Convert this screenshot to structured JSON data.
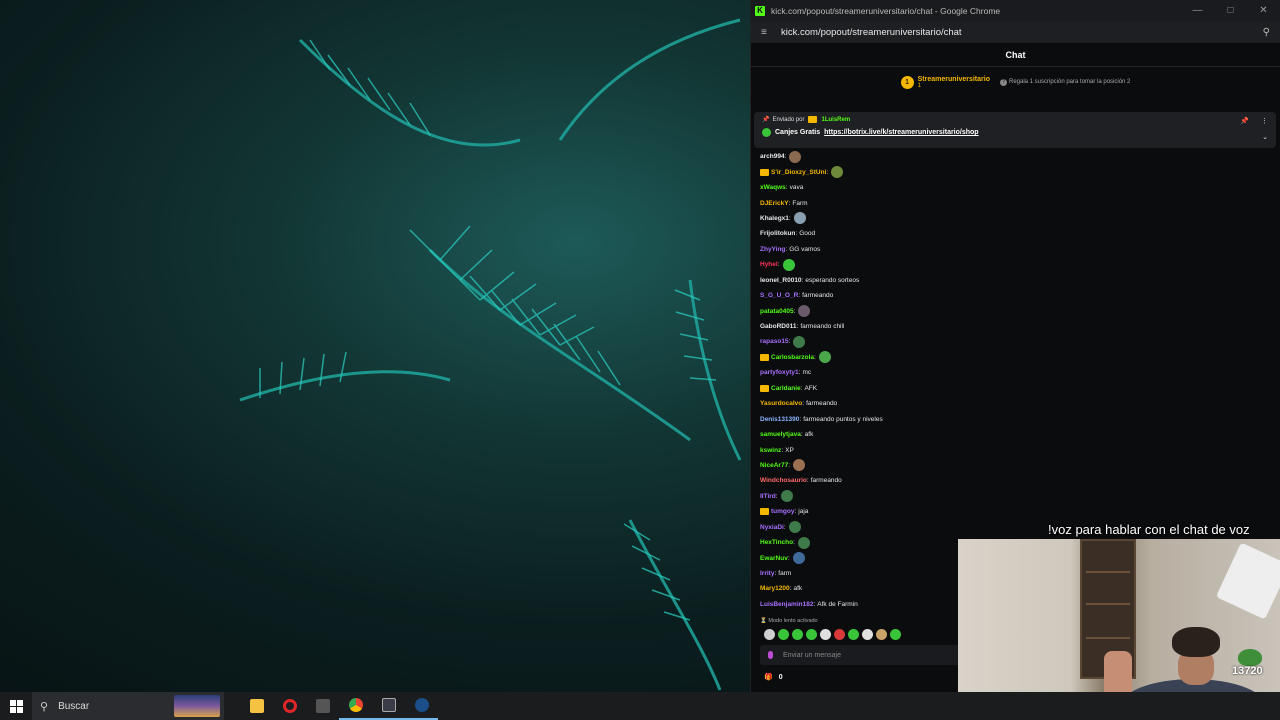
{
  "window": {
    "title": "kick.com/popout/streameruniversitario/chat - Google Chrome",
    "favicon": "K",
    "url": "kick.com/popout/streameruniversitario/chat"
  },
  "chat": {
    "header": "Chat",
    "leaderboard": {
      "rank": "1",
      "name": "Streameruniversitario",
      "count": "1",
      "tip": "Regala 1 suscripción para tomar la posición 2"
    },
    "pinned": {
      "sent_by_label": "Enviado por",
      "sent_by_user": "1LuisRem",
      "title": "Canjes Gratis",
      "link": "https://botrix.live/k/streameruniversitario/shop"
    },
    "messages": [
      {
        "user": "arch994",
        "text": "",
        "color": "#e6e6e6",
        "badge": false,
        "emote": "#8a6a50"
      },
      {
        "user": "S'ir_Dioxzy_StUni",
        "text": "",
        "color": "#f5b800",
        "badge": true,
        "emote": "#6f8a3a"
      },
      {
        "user": "xWaqws",
        "text": "vava",
        "color": "#53fc18",
        "badge": false,
        "emote": ""
      },
      {
        "user": "DJErickY",
        "text": "Farm",
        "color": "#f5b800",
        "badge": false,
        "emote": ""
      },
      {
        "user": "Khalegx1",
        "text": "",
        "color": "#e6e6e6",
        "badge": false,
        "emote": "#8aa0b0"
      },
      {
        "user": "Frijolitokun",
        "text": "Good",
        "color": "#e6e6e6",
        "badge": false,
        "emote": ""
      },
      {
        "user": "ZhyYing",
        "text": "GG vamos",
        "color": "#a970ff",
        "badge": false,
        "emote": ""
      },
      {
        "user": "Hyhel",
        "text": "",
        "color": "#ff3355",
        "badge": false,
        "emote": "#3ac43a"
      },
      {
        "user": "leonel_R0010",
        "text": "esperando sorteos",
        "color": "#e6e6e6",
        "badge": false,
        "emote": ""
      },
      {
        "user": "S_G_U_O_R",
        "text": "farmeando",
        "color": "#a970ff",
        "badge": false,
        "emote": ""
      },
      {
        "user": "patata0405",
        "text": "",
        "color": "#53fc18",
        "badge": false,
        "emote": "#6a5a6a"
      },
      {
        "user": "GaboRD011",
        "text": "farmeando chill",
        "color": "#e6e6e6",
        "badge": false,
        "emote": ""
      },
      {
        "user": "rapaso15",
        "text": "",
        "color": "#a970ff",
        "badge": false,
        "emote": "#3f7a4a"
      },
      {
        "user": "Carlosbarzola",
        "text": "",
        "color": "#53fc18",
        "badge": true,
        "emote": "#4aa84a"
      },
      {
        "user": "partyfoxyty1",
        "text": "mc",
        "color": "#a970ff",
        "badge": false,
        "emote": ""
      },
      {
        "user": "Carldanie",
        "text": "AFK",
        "color": "#53fc18",
        "badge": true,
        "emote": ""
      },
      {
        "user": "Yasurdocalvo",
        "text": "farmeando",
        "color": "#f5b800",
        "badge": false,
        "emote": ""
      },
      {
        "user": "Denis131390",
        "text": "farmeando puntos y niveles",
        "color": "#8ab4ff",
        "badge": false,
        "emote": ""
      },
      {
        "user": "samuelytjava",
        "text": "afk",
        "color": "#53fc18",
        "badge": false,
        "emote": ""
      },
      {
        "user": "kswinz",
        "text": "XP",
        "color": "#53fc18",
        "badge": false,
        "emote": ""
      },
      {
        "user": "NiceAr77",
        "text": "",
        "color": "#53fc18",
        "badge": false,
        "emote": "#9a7050"
      },
      {
        "user": "Windchosaurio",
        "text": "farmeando",
        "color": "#ff6a6a",
        "badge": false,
        "emote": ""
      },
      {
        "user": "IITird",
        "text": "",
        "color": "#a970ff",
        "badge": false,
        "emote": "#3f7a4a"
      },
      {
        "user": "tumgoy",
        "text": "jaja",
        "color": "#a970ff",
        "badge": true,
        "emote": ""
      },
      {
        "user": "NyxiaDi",
        "text": "",
        "color": "#a970ff",
        "badge": false,
        "emote": "#3f7a4a"
      },
      {
        "user": "HexTincho",
        "text": "",
        "color": "#53fc18",
        "badge": false,
        "emote": "#3f7a4a"
      },
      {
        "user": "EwarNuv",
        "text": "",
        "color": "#53fc18",
        "badge": false,
        "emote": "#3f6a9a"
      },
      {
        "user": "Irrity",
        "text": "farm",
        "color": "#a970ff",
        "badge": false,
        "emote": ""
      },
      {
        "user": "Mary1200",
        "text": "afk",
        "color": "#f5b800",
        "badge": false,
        "emote": ""
      },
      {
        "user": "LuisBenjamin182",
        "text": "Afk de Farmin",
        "color": "#a970ff",
        "badge": false,
        "emote": ""
      }
    ],
    "slow_mode": "Modo lento activado",
    "quick_emotes": [
      "#cfcfcf",
      "#3ac43a",
      "#3ac43a",
      "#3ac43a",
      "#e0e0e0",
      "#d83a3a",
      "#3ac43a",
      "#e0e0e0",
      "#c9a36a",
      "#3ac43a"
    ],
    "input_placeholder": "Enviar un mensaje",
    "points": "0"
  },
  "overlay": {
    "caption": "!voz para hablar con el chat de voz",
    "viewers": "13720"
  },
  "taskbar": {
    "search_label": "Buscar",
    "icons": [
      "file-explorer-icon",
      "opera-icon",
      "calculator-icon",
      "chrome-icon",
      "media-player-icon",
      "steam-icon"
    ]
  }
}
